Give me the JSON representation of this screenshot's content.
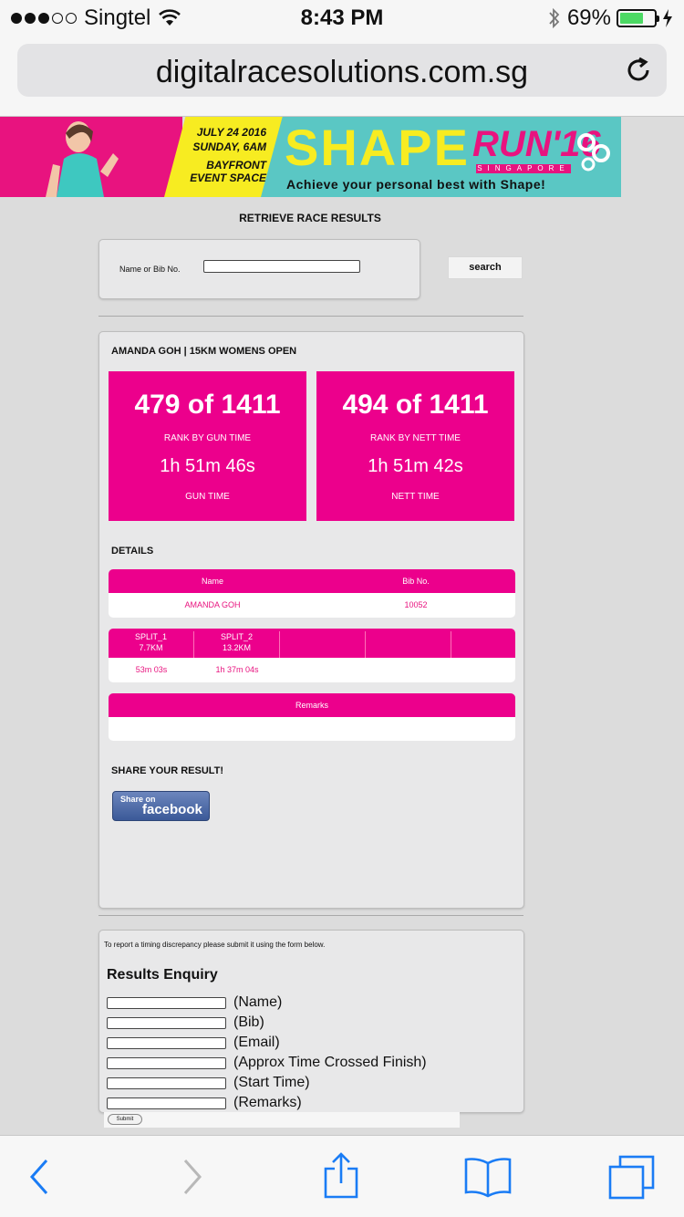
{
  "status_bar": {
    "carrier": "Singtel",
    "time": "8:43 PM",
    "battery": "69%",
    "battery_level": 0.69
  },
  "browser": {
    "url": "digitalracesolutions.com.sg"
  },
  "banner": {
    "date": "JULY 24 2016",
    "day_time": "SUNDAY, 6AM",
    "venue_line1": "BAYFRONT",
    "venue_line2": "EVENT SPACE",
    "shape": "SHAPE",
    "run": "RUN'16",
    "singapore": "SINGAPORE",
    "tagline": "Achieve your personal best with Shape!",
    "colors": {
      "pink": "#e8137f",
      "yellow": "#f7ec21",
      "teal": "#5ac7c4"
    }
  },
  "page": {
    "heading": "RETRIEVE RACE RESULTS"
  },
  "search": {
    "label": "Name or Bib No.",
    "value": "",
    "button": "search"
  },
  "result": {
    "runner_title": "AMANDA GOH | 15KM WOMENS OPEN",
    "gun": {
      "rank": "479 of 1411",
      "rank_label": "RANK BY GUN TIME",
      "time": "1h 51m 46s",
      "time_label": "GUN TIME"
    },
    "nett": {
      "rank": "494 of 1411",
      "rank_label": "RANK BY NETT TIME",
      "time": "1h 51m 42s",
      "time_label": "NETT TIME"
    },
    "accent_color": "#ec008c"
  },
  "details": {
    "heading": "DETAILS",
    "columns": [
      "Name",
      "Bib No."
    ],
    "row": [
      "AMANDA GOH",
      "10052"
    ]
  },
  "splits": {
    "headers": [
      {
        "line1": "SPLIT_1",
        "line2": "7.7KM"
      },
      {
        "line1": "SPLIT_2",
        "line2": "13.2KM"
      },
      {
        "line1": "",
        "line2": ""
      },
      {
        "line1": "",
        "line2": ""
      },
      {
        "line1": "",
        "line2": ""
      }
    ],
    "values": [
      "53m 03s",
      "1h 37m 04s",
      "",
      "",
      ""
    ]
  },
  "remarks": {
    "header": "Remarks",
    "value": ""
  },
  "share": {
    "heading": "SHARE YOUR RESULT!",
    "fb_line1": "Share on",
    "fb_line2": "facebook"
  },
  "enquiry": {
    "note": "To report a timing discrepancy please submit it using the form below.",
    "title": "Results Enquiry",
    "fields": [
      "(Name)",
      "(Bib)",
      "(Email)",
      "(Approx Time Crossed Finish)",
      "(Start Time)",
      "(Remarks)"
    ],
    "submit": "Submit"
  },
  "toolbar": {
    "icons": [
      "back-icon",
      "forward-icon",
      "share-icon",
      "bookmarks-icon",
      "tabs-icon"
    ]
  }
}
